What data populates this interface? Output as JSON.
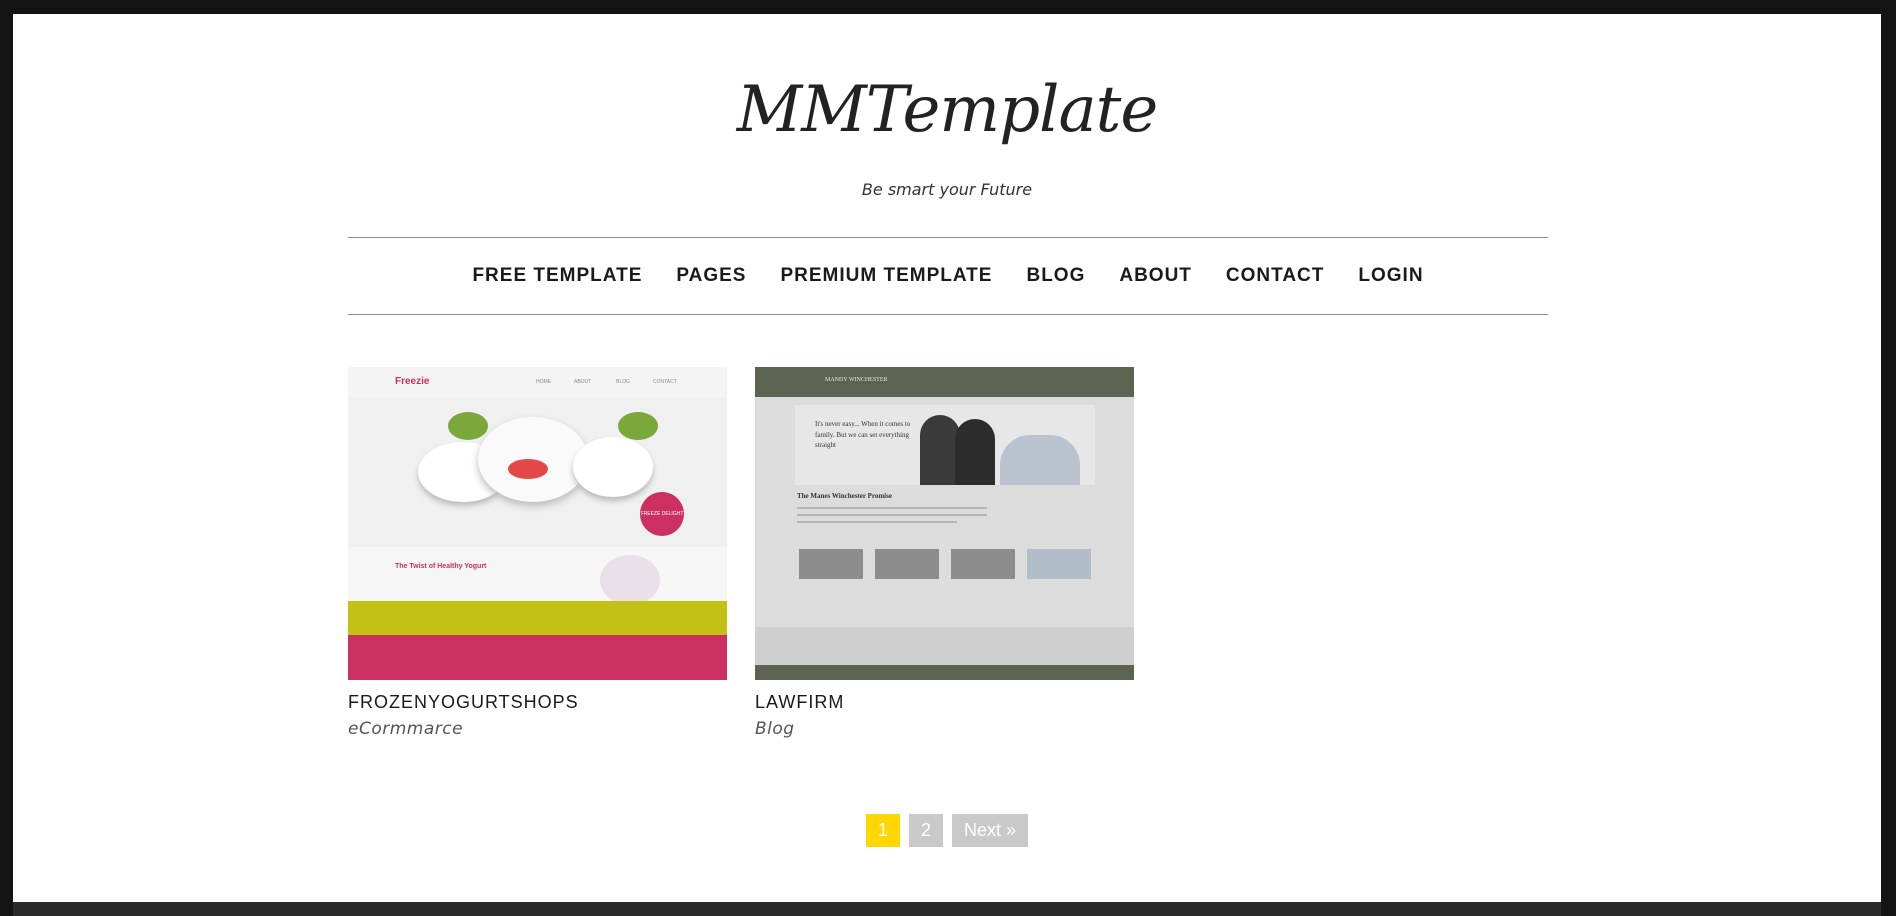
{
  "site": {
    "logo": "MMTemplate",
    "tagline": "Be smart your Future"
  },
  "nav": {
    "items": [
      {
        "label": "FREE TEMPLATE"
      },
      {
        "label": "PAGES"
      },
      {
        "label": "PREMIUM TEMPLATE"
      },
      {
        "label": "BLOG"
      },
      {
        "label": "ABOUT"
      },
      {
        "label": "CONTACT"
      },
      {
        "label": "LOGIN"
      }
    ]
  },
  "cards": [
    {
      "title": "FROZENYOGURTSHOPS",
      "category": "eCormmarce",
      "thumb": {
        "brand": "Freezie",
        "menu": [
          "HOME",
          "ABOUT",
          "BLOG",
          "CONTACT"
        ],
        "heading": "The Twist of Healthy Yogurt",
        "badge": "FREEZE DELIGHT"
      }
    },
    {
      "title": "LAWFIRM",
      "category": "Blog",
      "thumb": {
        "brand": "MANDY WINCHESTER",
        "tagline": "It's never easy... When it comes to family. But we can set everything straight",
        "heading": "The Manes Winchester Promise"
      }
    }
  ],
  "pagination": {
    "pages": [
      "1",
      "2"
    ],
    "next": "Next »",
    "current": "1"
  },
  "colors": {
    "accent": "#ffd700",
    "pager_inactive": "#c9c9c9",
    "frame": "#141414"
  }
}
